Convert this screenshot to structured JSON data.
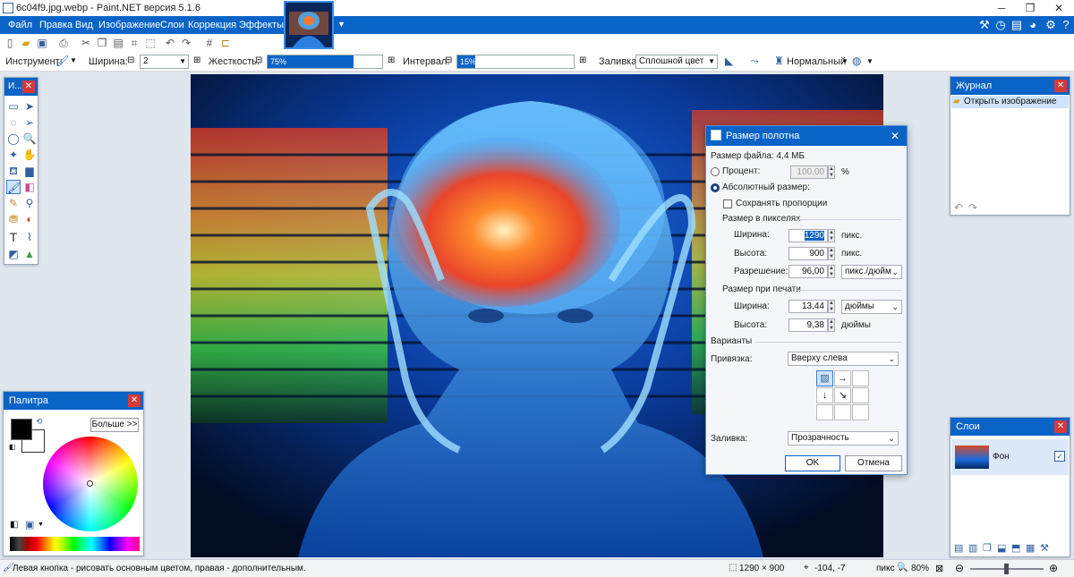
{
  "window": {
    "title": "6c04f9.jpg.webp - Paint.NET версия 5.1.6",
    "minimize": "─",
    "maximize": "❐",
    "close": "✕"
  },
  "menu": [
    "Файл",
    "Правка",
    "Вид",
    "Изображение",
    "Слои",
    "Коррекция",
    "Эффекты"
  ],
  "toolbar": {
    "tool_label": "Инструмент:",
    "width_label": "Ширина:",
    "width_value": "2",
    "hardness_label": "Жесткость:",
    "hardness_value": "75%",
    "hardness_fraction": 0.75,
    "interval_label": "Интервал:",
    "interval_value": "15%",
    "interval_fraction": 0.15,
    "fill_label": "Заливка:",
    "fill_value": "Сплошной цвет",
    "blend_value": "Нормальный"
  },
  "tools_panel": {
    "title": "И..."
  },
  "history_panel": {
    "title": "Журнал",
    "items": [
      "Открыть изображение"
    ]
  },
  "palette_panel": {
    "title": "Палитра",
    "more_button": "Больше >>"
  },
  "layers_panel": {
    "title": "Слои",
    "layers": [
      {
        "name": "Фон",
        "visible": true
      }
    ]
  },
  "dialog": {
    "title": "Размер полотна",
    "file_size": "Размер файла: 4,4 МБ",
    "percent_label": "Процент:",
    "percent_value": "100,00",
    "percent_unit": "%",
    "absolute_label": "Абсолютный размер:",
    "keep_ratio_label": "Сохранять пропорции",
    "pixels_group": "Размер в пикселях",
    "width_label": "Ширина:",
    "width_value": "1290",
    "width_unit": "пикс.",
    "height_label": "Высота:",
    "height_value": "900",
    "height_unit": "пикс.",
    "resolution_label": "Разрешение:",
    "resolution_value": "96,00",
    "resolution_unit": "пикс./дюйм",
    "print_group": "Размер при печати",
    "print_width_label": "Ширина:",
    "print_width_value": "13,44",
    "print_width_unit": "дюймы",
    "print_height_label": "Высота:",
    "print_height_value": "9,38",
    "print_height_unit": "дюймы",
    "variants_group": "Варианты",
    "anchor_label": "Привязка:",
    "anchor_value": "Вверху слева",
    "fill_label": "Заливка:",
    "fill_value": "Прозрачность",
    "ok": "OK",
    "cancel": "Отмена"
  },
  "status": {
    "hint": "Левая кнопка - рисовать основным цветом, правая - дополнительным.",
    "image_size": "1290 × 900",
    "cursor": "-104, -7",
    "unit": "пикс",
    "zoom": "80%"
  }
}
